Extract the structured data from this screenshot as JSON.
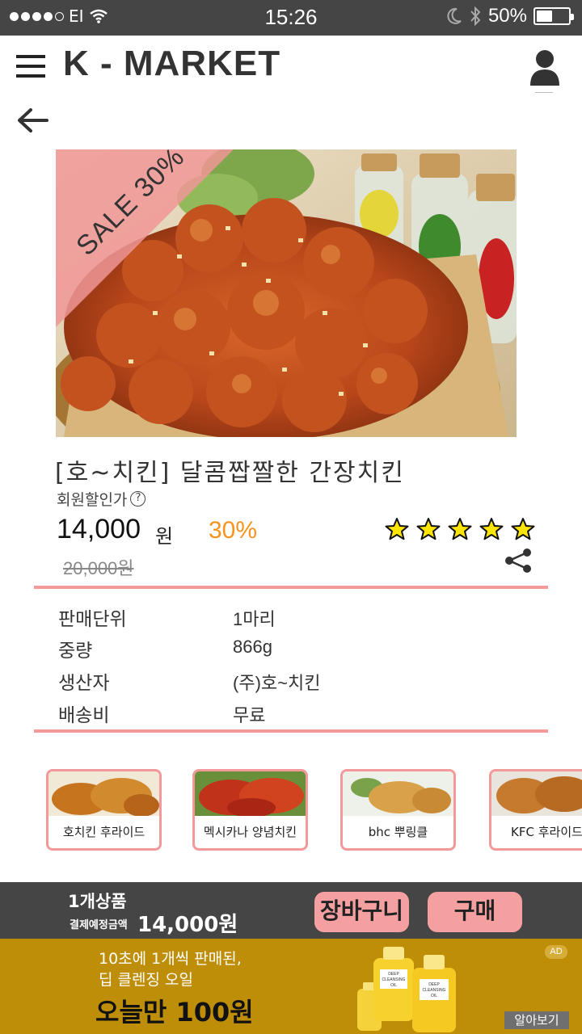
{
  "status_bar": {
    "carrier": "EI",
    "time": "15:26",
    "battery_text": "50%",
    "battery_level": 0.5
  },
  "header": {
    "title": "K  -  MARKET"
  },
  "product": {
    "sale_badge": "SALE 30%",
    "title": "[호~치킨] 달콤짭짤한 간장치킨",
    "member_price_label": "회원할인가",
    "price": "14,000",
    "price_unit": "원",
    "discount": "30%",
    "original_price": "20,000원",
    "rating": 5,
    "rating_max": 5
  },
  "specs": [
    {
      "label": "판매단위",
      "value": "1마리"
    },
    {
      "label": "중량",
      "value": "866g"
    },
    {
      "label": "생산자",
      "value": "(주)호~치킨"
    },
    {
      "label": "배송비",
      "value": "무료"
    }
  ],
  "related": [
    {
      "label": "호치킨 후라이드"
    },
    {
      "label": "멕시카나 양념치킨"
    },
    {
      "label": "bhc 뿌링클"
    },
    {
      "label": "KFC 후라이드"
    }
  ],
  "bottom_bar": {
    "item_count": "1개상품",
    "payment_label": "결제예정금액",
    "total": "14,000원",
    "cart_button": "장바구니",
    "buy_button": "구매"
  },
  "ad": {
    "line1": "10초에 1개씩 판매된,",
    "line2": "딥 클렌징 오일",
    "offer": "오늘만 100원",
    "badge": "AD",
    "more_button": "알아보기",
    "bottle_label_line1": "DEEP",
    "bottle_label_line2": "CLEANSING",
    "bottle_label_line3": "OIL"
  },
  "colors": {
    "accent_pink": "#f29a9a",
    "discount_orange": "#f7931e",
    "star_yellow": "#ffe600",
    "ad_gold": "#bf8e08",
    "bar_gray": "#454545"
  }
}
